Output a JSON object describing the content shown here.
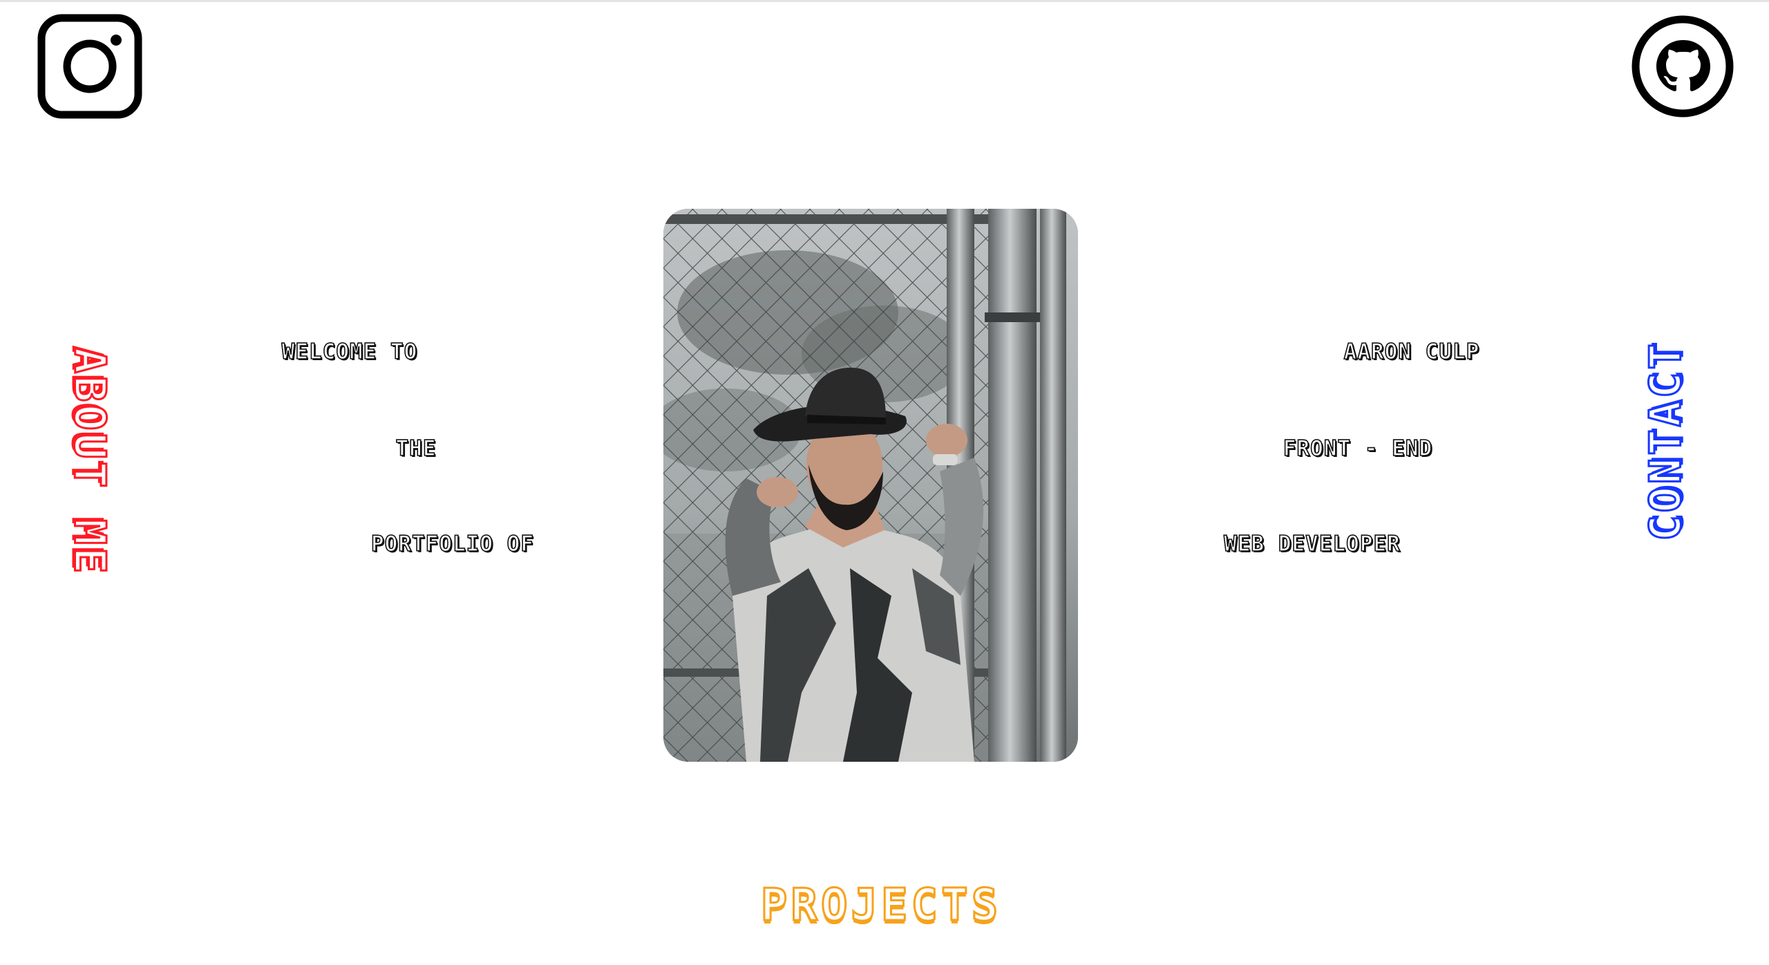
{
  "social": {
    "instagram_icon": "instagram-icon",
    "github_icon": "github-icon"
  },
  "nav": {
    "about": "ABOUT ME",
    "contact": "CONTACT",
    "projects": "PROJECTS"
  },
  "intro": {
    "left": [
      "WELCOME TO",
      "THE",
      "PORTFOLIO OF"
    ],
    "right": [
      "AARON CULP",
      "FRONT - END",
      "WEB DEVELOPER"
    ]
  },
  "colors": {
    "about": "#ff1a24",
    "contact": "#1737ff",
    "projects": "#f7a21b",
    "text_outline": "#111111",
    "background": "#ffffff"
  }
}
